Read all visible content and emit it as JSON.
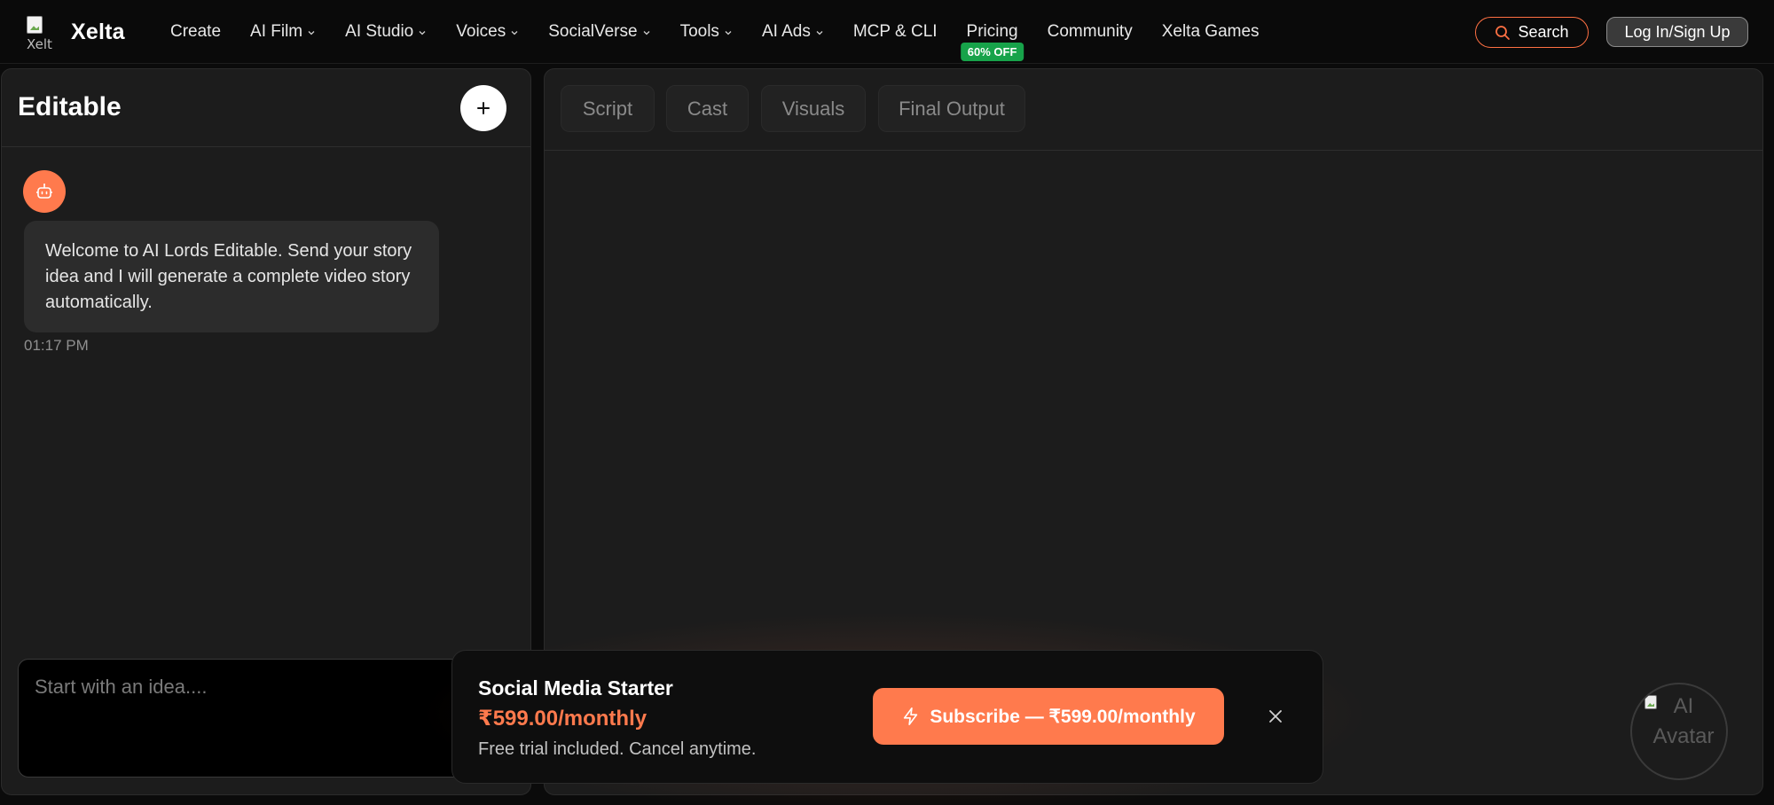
{
  "nav": {
    "logo_alt": "Xelt",
    "brand": "Xelta",
    "items": [
      {
        "label": "Create",
        "dropdown": false
      },
      {
        "label": "AI Film",
        "dropdown": true
      },
      {
        "label": "AI Studio",
        "dropdown": true
      },
      {
        "label": "Voices",
        "dropdown": true
      },
      {
        "label": "SocialVerse",
        "dropdown": true
      },
      {
        "label": "Tools",
        "dropdown": true
      },
      {
        "label": "AI Ads",
        "dropdown": true
      },
      {
        "label": "MCP & CLI",
        "dropdown": false
      },
      {
        "label": "Pricing",
        "dropdown": false,
        "badge": "60% OFF"
      },
      {
        "label": "Community",
        "dropdown": false
      },
      {
        "label": "Xelta Games",
        "dropdown": false
      }
    ],
    "search_label": "Search",
    "login_label": "Log In/Sign Up"
  },
  "chat": {
    "title": "Editable",
    "bot_icon": "robot-icon",
    "messages": [
      {
        "text": "Welcome to AI Lords Editable. Send your story idea and I will generate a complete video story automatically.",
        "time": "01:17 PM"
      }
    ],
    "input_placeholder": "Start with an idea...."
  },
  "workspace": {
    "tabs": [
      "Script",
      "Cast",
      "Visuals",
      "Final Output"
    ],
    "avatar_alt": "AI Avatar"
  },
  "promo": {
    "plan": "Social Media Starter",
    "price": "₹599.00/monthly",
    "note": "Free trial included. Cancel anytime.",
    "button_label": "Subscribe — ₹599.00/monthly"
  },
  "colors": {
    "accent": "#ff7a4d",
    "badge_green": "#17a34a",
    "panel": "#1c1c1c",
    "background": "#0b0b0b"
  }
}
